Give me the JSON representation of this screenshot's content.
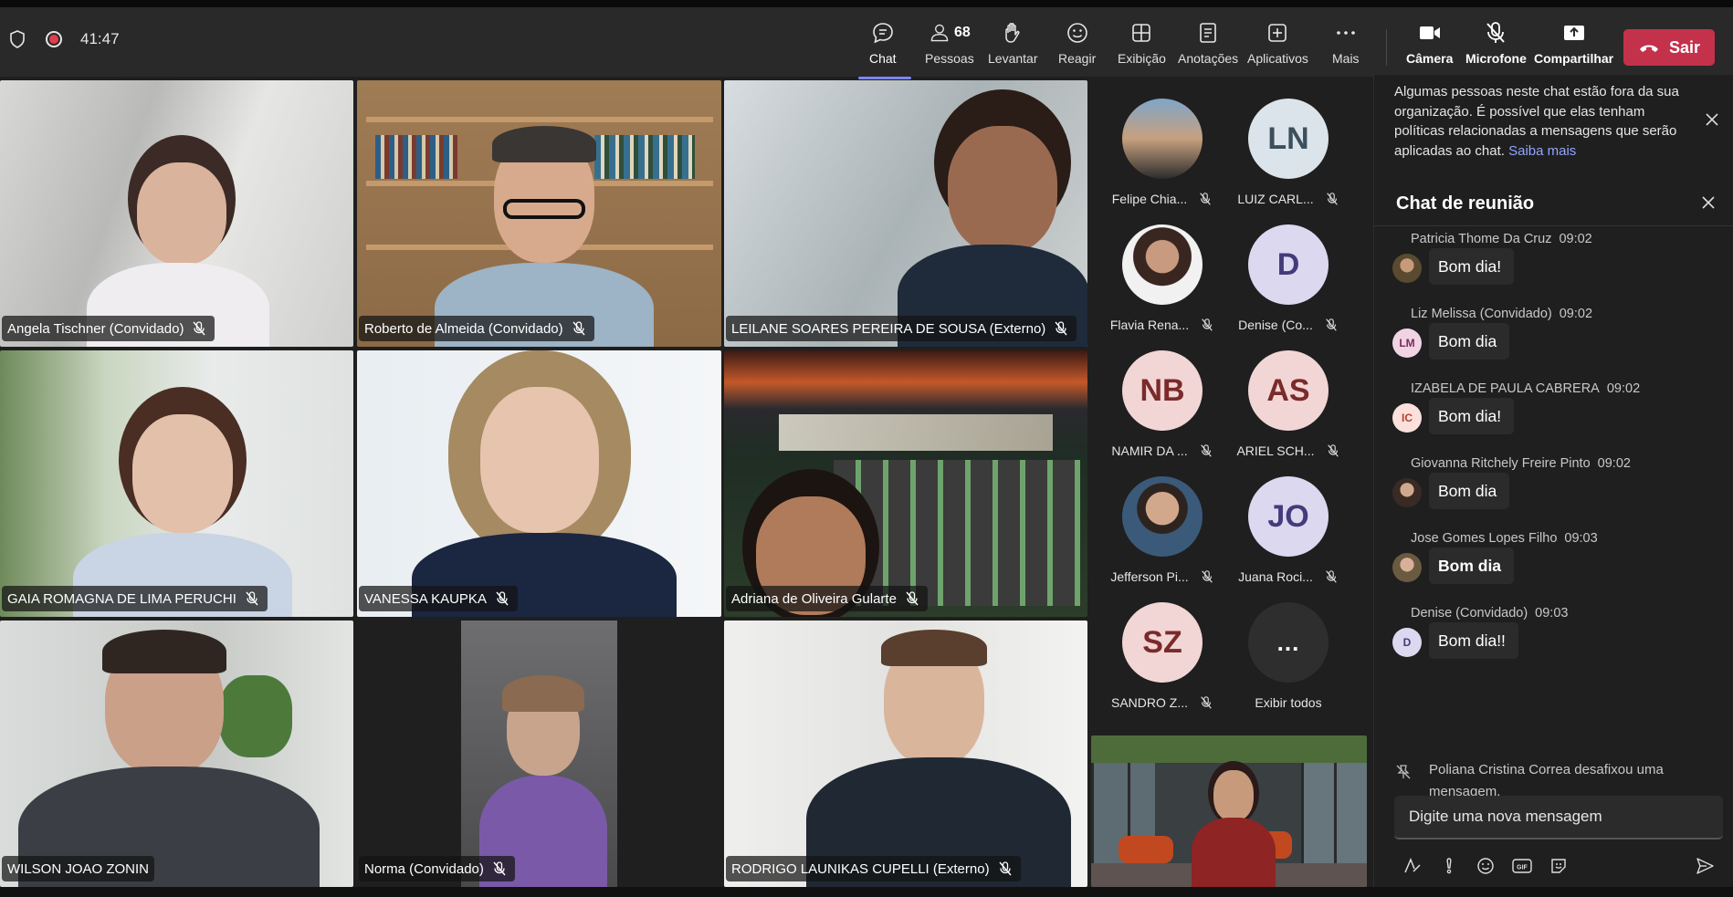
{
  "meeting": {
    "timer": "41:47"
  },
  "toolbar": {
    "chat_label": "Chat",
    "people_label": "Pessoas",
    "people_count": "68",
    "raise_label": "Levantar",
    "react_label": "Reagir",
    "view_label": "Exibição",
    "notes_label": "Anotações",
    "apps_label": "Aplicativos",
    "more_label": "Mais",
    "camera_label": "Câmera",
    "mic_label": "Microfone",
    "share_label": "Compartilhar",
    "leave_label": "Sair"
  },
  "tiles": [
    {
      "name": "Angela Tischner (Convidado)"
    },
    {
      "name": "Roberto de Almeida (Convidado)"
    },
    {
      "name": "LEILANE SOARES PEREIRA DE SOUSA (Externo)"
    },
    {
      "name": "GAIA ROMAGNA DE LIMA PERUCHI"
    },
    {
      "name": "VANESSA KAUPKA"
    },
    {
      "name": "Adriana de Oliveira Gularte"
    },
    {
      "name": "WILSON JOAO ZONIN"
    },
    {
      "name": "Norma (Convidado)"
    },
    {
      "name": "RODRIGO LAUNIKAS CUPELLI (Externo)"
    }
  ],
  "roster": [
    {
      "name": "Felipe Chia...",
      "initials": ""
    },
    {
      "name": "LUIZ CARL...",
      "initials": "LN"
    },
    {
      "name": "Flavia Rena...",
      "initials": ""
    },
    {
      "name": "Denise (Co...",
      "initials": "D"
    },
    {
      "name": "NAMIR DA ...",
      "initials": "NB"
    },
    {
      "name": "ARIEL SCH...",
      "initials": "AS"
    },
    {
      "name": "Jefferson Pi...",
      "initials": ""
    },
    {
      "name": "Juana Roci...",
      "initials": "JO"
    },
    {
      "name": "SANDRO Z...",
      "initials": "SZ"
    },
    {
      "name": "Exibir todos",
      "initials": "..."
    }
  ],
  "chat": {
    "notice": "Algumas pessoas neste chat estão fora da sua organização. É possível que elas tenham políticas relacionadas a mensagens que serão aplicadas ao chat.",
    "notice_link": "Saiba mais",
    "title": "Chat de reunião",
    "messages": [
      {
        "sender": "Patricia Thome Da Cruz",
        "time": "09:02",
        "text": "Bom dia!",
        "initials": ""
      },
      {
        "sender": "Liz Melissa (Convidado)",
        "time": "09:02",
        "text": "Bom dia",
        "initials": "LM"
      },
      {
        "sender": "IZABELA DE PAULA CABRERA",
        "time": "09:02",
        "text": "Bom dia!",
        "initials": "IC"
      },
      {
        "sender": "Giovanna Ritchely Freire Pinto",
        "time": "09:02",
        "text": "Bom dia",
        "initials": ""
      },
      {
        "sender": "Jose Gomes Lopes Filho",
        "time": "09:03",
        "text": "Bom dia",
        "initials": ""
      },
      {
        "sender": "Denise (Convidado)",
        "time": "09:03",
        "text": "Bom dia!!",
        "initials": "D"
      }
    ],
    "system_message": "Poliana Cristina Correa desafixou uma mensagem.",
    "composer_placeholder": "Digite uma nova mensagem"
  },
  "colors": {
    "accent": "#7f85f5",
    "leave": "#c4314b",
    "toolbar": "#292929",
    "stage": "#1f1f1f"
  }
}
